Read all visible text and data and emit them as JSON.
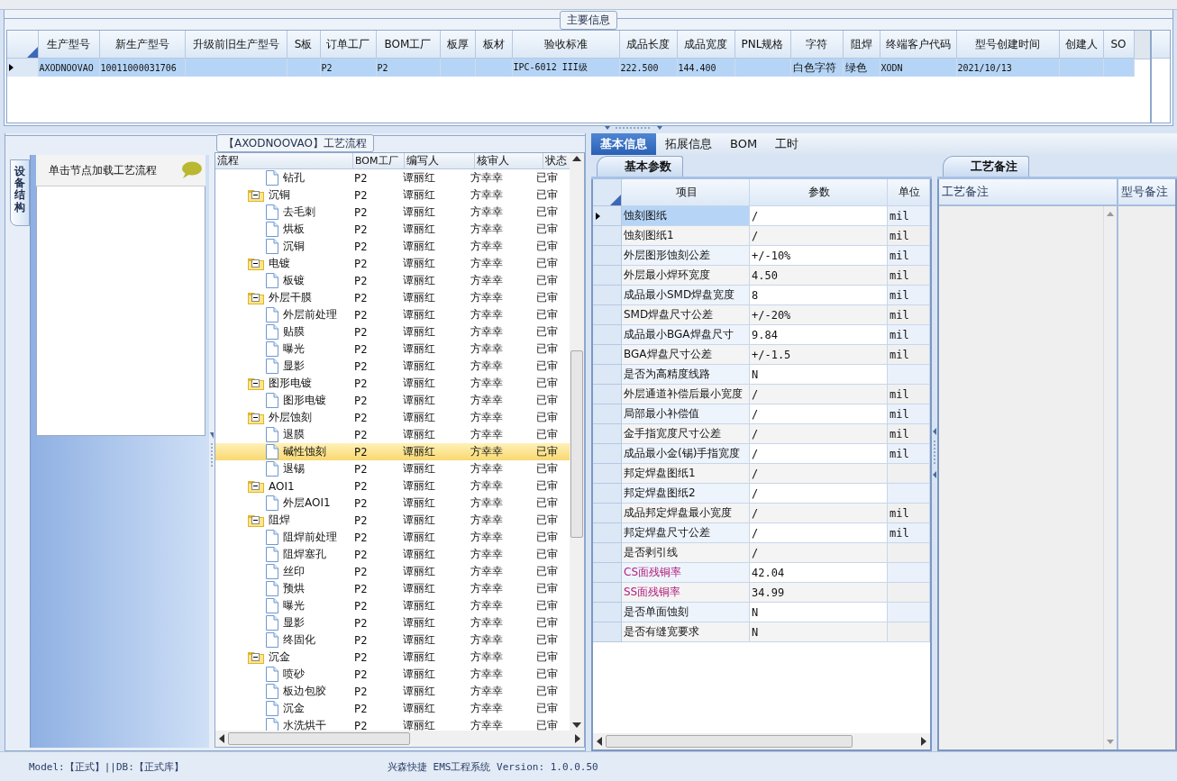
{
  "main_info": {
    "title": "主要信息",
    "columns": [
      "生产型号",
      "新生产型号",
      "升级前旧生产型号",
      "S板",
      "订单工厂",
      "BOM工厂",
      "板厚",
      "板材",
      "验收标准",
      "成品长度",
      "成品宽度",
      "PNL规格",
      "字符",
      "阻焊",
      "终端客户代码",
      "型号创建时间",
      "创建人",
      "SO"
    ],
    "rows": [
      {
        "selected": true,
        "cells": [
          "AXODNOOVAO",
          "10011000031706",
          "",
          "",
          "P2",
          "P2",
          "",
          "",
          "IPC-6012 III级",
          "222.500",
          "144.400",
          "",
          "白色字符",
          "绿色",
          "XODN",
          "2021/10/13",
          "",
          ""
        ]
      }
    ]
  },
  "process": {
    "title": "【AXODNOOVAO】工艺流程",
    "side_tab": "设备结构",
    "hint": "单击节点加载工艺流程",
    "columns": [
      "流程",
      "BOM工厂",
      "编写人",
      "核审人",
      "状态"
    ],
    "tree": [
      {
        "kind": "continued",
        "children": [
          {
            "label": "钻孔",
            "bom": "P2",
            "writer": "谭丽红",
            "reviewer": "方幸幸",
            "status": "已审",
            "selected": false
          }
        ]
      },
      {
        "kind": "folder",
        "label": "沉铜",
        "bom": "P2",
        "writer": "谭丽红",
        "reviewer": "方幸幸",
        "status": "已审",
        "selected": false,
        "expanded": true,
        "children": [
          {
            "label": "去毛刺",
            "bom": "P2",
            "writer": "谭丽红",
            "reviewer": "方幸幸",
            "status": "已审",
            "selected": false
          },
          {
            "label": "烘板",
            "bom": "P2",
            "writer": "谭丽红",
            "reviewer": "方幸幸",
            "status": "已审",
            "selected": false
          },
          {
            "label": "沉铜",
            "bom": "P2",
            "writer": "谭丽红",
            "reviewer": "方幸幸",
            "status": "已审",
            "selected": false
          }
        ]
      },
      {
        "kind": "folder",
        "label": "电镀",
        "bom": "P2",
        "writer": "谭丽红",
        "reviewer": "方幸幸",
        "status": "已审",
        "selected": false,
        "expanded": true,
        "children": [
          {
            "label": "板镀",
            "bom": "P2",
            "writer": "谭丽红",
            "reviewer": "方幸幸",
            "status": "已审",
            "selected": false
          }
        ]
      },
      {
        "kind": "folder",
        "label": "外层干膜",
        "bom": "P2",
        "writer": "谭丽红",
        "reviewer": "方幸幸",
        "status": "已审",
        "selected": false,
        "expanded": true,
        "children": [
          {
            "label": "外层前处理",
            "bom": "P2",
            "writer": "谭丽红",
            "reviewer": "方幸幸",
            "status": "已审",
            "selected": false
          },
          {
            "label": "贴膜",
            "bom": "P2",
            "writer": "谭丽红",
            "reviewer": "方幸幸",
            "status": "已审",
            "selected": false
          },
          {
            "label": "曝光",
            "bom": "P2",
            "writer": "谭丽红",
            "reviewer": "方幸幸",
            "status": "已审",
            "selected": false
          },
          {
            "label": "显影",
            "bom": "P2",
            "writer": "谭丽红",
            "reviewer": "方幸幸",
            "status": "已审",
            "selected": false
          }
        ]
      },
      {
        "kind": "folder",
        "label": "图形电镀",
        "bom": "P2",
        "writer": "谭丽红",
        "reviewer": "方幸幸",
        "status": "已审",
        "selected": false,
        "expanded": true,
        "children": [
          {
            "label": "图形电镀",
            "bom": "P2",
            "writer": "谭丽红",
            "reviewer": "方幸幸",
            "status": "已审",
            "selected": false
          }
        ]
      },
      {
        "kind": "folder",
        "label": "外层蚀刻",
        "bom": "P2",
        "writer": "谭丽红",
        "reviewer": "方幸幸",
        "status": "已审",
        "selected": false,
        "expanded": true,
        "children": [
          {
            "label": "退膜",
            "bom": "P2",
            "writer": "谭丽红",
            "reviewer": "方幸幸",
            "status": "已审",
            "selected": false
          },
          {
            "label": "碱性蚀刻",
            "bom": "P2",
            "writer": "谭丽红",
            "reviewer": "方幸幸",
            "status": "已审",
            "selected": true
          },
          {
            "label": "退锡",
            "bom": "P2",
            "writer": "谭丽红",
            "reviewer": "方幸幸",
            "status": "已审",
            "selected": false
          }
        ]
      },
      {
        "kind": "folder",
        "label": "AOI1",
        "bom": "P2",
        "writer": "谭丽红",
        "reviewer": "方幸幸",
        "status": "已审",
        "selected": false,
        "expanded": true,
        "children": [
          {
            "label": "外层AOI1",
            "bom": "P2",
            "writer": "谭丽红",
            "reviewer": "方幸幸",
            "status": "已审",
            "selected": false
          }
        ]
      },
      {
        "kind": "folder",
        "label": "阻焊",
        "bom": "P2",
        "writer": "谭丽红",
        "reviewer": "方幸幸",
        "status": "已审",
        "selected": false,
        "expanded": true,
        "children": [
          {
            "label": "阻焊前处理",
            "bom": "P2",
            "writer": "谭丽红",
            "reviewer": "方幸幸",
            "status": "已审",
            "selected": false
          },
          {
            "label": "阻焊塞孔",
            "bom": "P2",
            "writer": "谭丽红",
            "reviewer": "方幸幸",
            "status": "已审",
            "selected": false
          },
          {
            "label": "丝印",
            "bom": "P2",
            "writer": "谭丽红",
            "reviewer": "方幸幸",
            "status": "已审",
            "selected": false
          },
          {
            "label": "预烘",
            "bom": "P2",
            "writer": "谭丽红",
            "reviewer": "方幸幸",
            "status": "已审",
            "selected": false
          },
          {
            "label": "曝光",
            "bom": "P2",
            "writer": "谭丽红",
            "reviewer": "方幸幸",
            "status": "已审",
            "selected": false
          },
          {
            "label": "显影",
            "bom": "P2",
            "writer": "谭丽红",
            "reviewer": "方幸幸",
            "status": "已审",
            "selected": false
          },
          {
            "label": "终固化",
            "bom": "P2",
            "writer": "谭丽红",
            "reviewer": "方幸幸",
            "status": "已审",
            "selected": false
          }
        ]
      },
      {
        "kind": "folder",
        "label": "沉金",
        "bom": "P2",
        "writer": "谭丽红",
        "reviewer": "方幸幸",
        "status": "已审",
        "selected": false,
        "expanded": true,
        "children": [
          {
            "label": "喷砂",
            "bom": "P2",
            "writer": "谭丽红",
            "reviewer": "方幸幸",
            "status": "已审",
            "selected": false
          },
          {
            "label": "板边包胶",
            "bom": "P2",
            "writer": "谭丽红",
            "reviewer": "方幸幸",
            "status": "已审",
            "selected": false
          },
          {
            "label": "沉金",
            "bom": "P2",
            "writer": "谭丽红",
            "reviewer": "方幸幸",
            "status": "已审",
            "selected": false
          },
          {
            "label": "水洗烘干",
            "bom": "P2",
            "writer": "谭丽红",
            "reviewer": "方幸幸",
            "status": "已审",
            "selected": false
          }
        ]
      }
    ]
  },
  "detail_tabs": [
    {
      "label": "基本信息",
      "selected": true
    },
    {
      "label": "拓展信息",
      "selected": false
    },
    {
      "label": "BOM",
      "selected": false
    },
    {
      "label": "工时",
      "selected": false
    }
  ],
  "params": {
    "tab": "基本参数",
    "columns": [
      "项目",
      "参数",
      "单位"
    ],
    "rows": [
      {
        "item": "蚀刻图纸",
        "value": "/",
        "unit": "mil",
        "selected": true
      },
      {
        "item": "蚀刻图纸1",
        "value": "/",
        "unit": "mil",
        "selected": false
      },
      {
        "item": "外层图形蚀刻公差",
        "value": "+/-10%",
        "unit": "mil",
        "selected": false
      },
      {
        "item": "外层最小焊环宽度",
        "value": "4.50",
        "unit": "mil",
        "selected": false
      },
      {
        "item": "成品最小SMD焊盘宽度",
        "value": "8",
        "unit": "mil",
        "selected": false
      },
      {
        "item": "SMD焊盘尺寸公差",
        "value": "+/-20%",
        "unit": "mil",
        "selected": false
      },
      {
        "item": "成品最小BGA焊盘尺寸",
        "value": "9.84",
        "unit": "mil",
        "selected": false
      },
      {
        "item": "BGA焊盘尺寸公差",
        "value": "+/-1.5",
        "unit": "mil",
        "selected": false
      },
      {
        "item": "是否为高精度线路",
        "value": "N",
        "unit": "",
        "selected": false
      },
      {
        "item": "外层通道补偿后最小宽度",
        "value": "/",
        "unit": "mil",
        "selected": false
      },
      {
        "item": "局部最小补偿值",
        "value": "/",
        "unit": "mil",
        "selected": false
      },
      {
        "item": "金手指宽度尺寸公差",
        "value": "/",
        "unit": "mil",
        "selected": false
      },
      {
        "item": "成品最小金(锡)手指宽度",
        "value": "/",
        "unit": "mil",
        "selected": false
      },
      {
        "item": "邦定焊盘图纸1",
        "value": "/",
        "unit": "",
        "selected": false
      },
      {
        "item": "邦定焊盘图纸2",
        "value": "/",
        "unit": "",
        "selected": false
      },
      {
        "item": "成品邦定焊盘最小宽度",
        "value": "/",
        "unit": "mil",
        "selected": false
      },
      {
        "item": "邦定焊盘尺寸公差",
        "value": "/",
        "unit": "mil",
        "selected": false
      },
      {
        "item": "是否剥引线",
        "value": "/",
        "unit": "",
        "selected": false
      },
      {
        "item": "CS面残铜率",
        "value": "42.04",
        "unit": "",
        "selected": false,
        "color": "#b0207e"
      },
      {
        "item": "SS面残铜率",
        "value": "34.99",
        "unit": "",
        "selected": false,
        "color": "#b0207e"
      },
      {
        "item": "是否单面蚀刻",
        "value": "N",
        "unit": "",
        "selected": false
      },
      {
        "item": "是否有缝宽要求",
        "value": "N",
        "unit": "",
        "selected": false
      }
    ]
  },
  "notes": {
    "tab": "工艺备注",
    "columns": [
      "工艺备注",
      "型号备注"
    ]
  },
  "status_bar": {
    "left": "Model:【正式】||DB:【正式库】",
    "right": "兴森快捷 EMS工程系统 Version: 1.0.0.50"
  }
}
